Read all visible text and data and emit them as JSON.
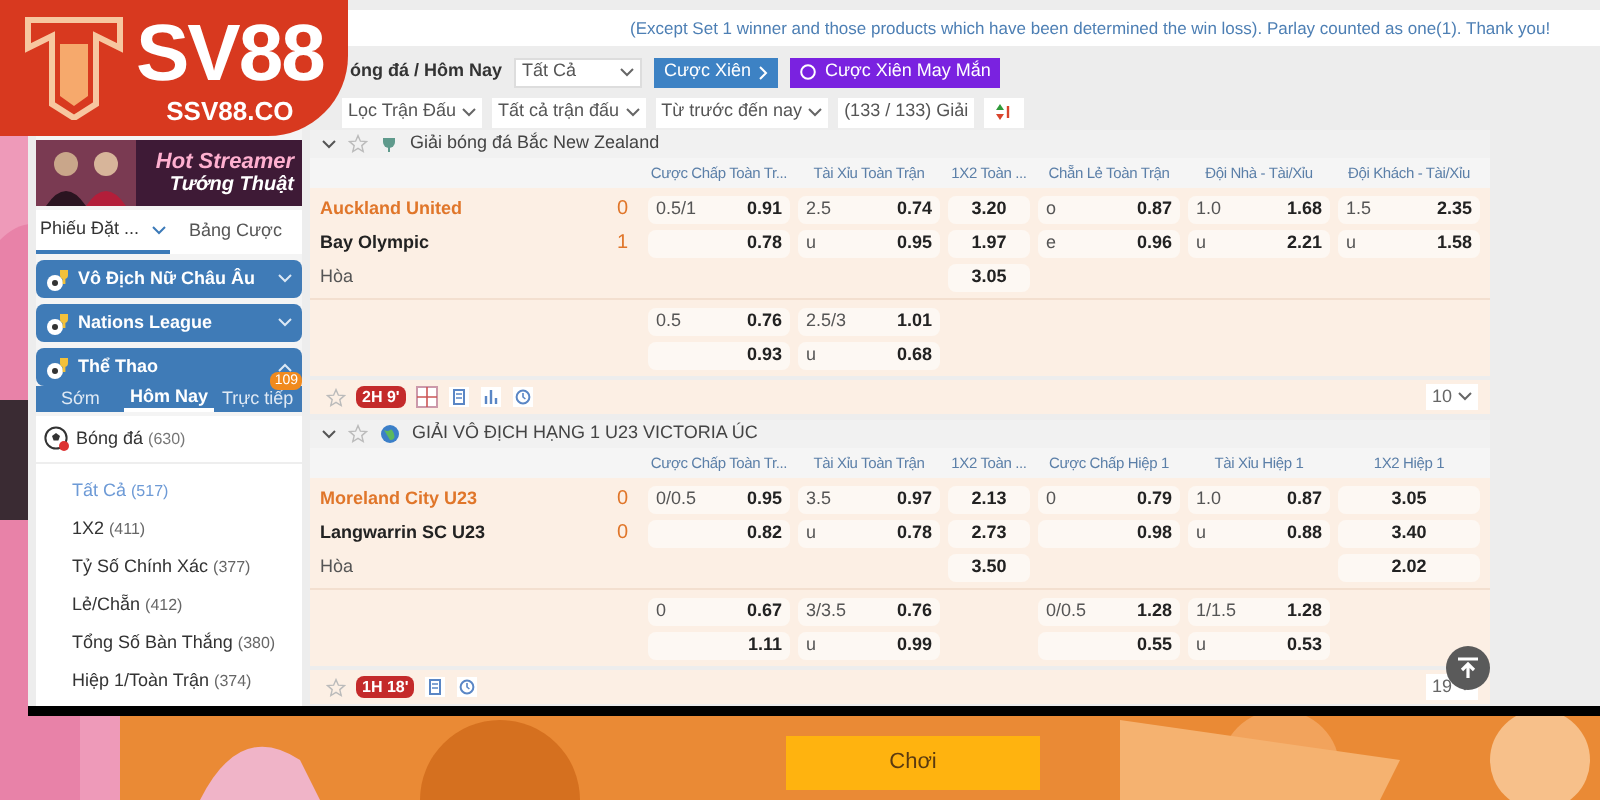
{
  "logo": {
    "name": "SV88",
    "domain": "SSV88.CO"
  },
  "notice": "(Except Set 1 winner and those products which have been determined the win loss). Parlay counted as one(1). Thank you!",
  "toolbar": {
    "breadcrumb": "óng đá / Hôm Nay",
    "market_select": "Tất Cả",
    "buttons": [
      {
        "label": "Cược Xiên",
        "kind": "parlay"
      },
      {
        "label": "Cược Xiên May Mắn",
        "kind": "lucky"
      }
    ]
  },
  "filters": [
    {
      "label": "Lọc Trận Đấu",
      "kind": "dropdown"
    },
    {
      "label": "Tất cả trận đấu",
      "kind": "dropdown"
    },
    {
      "label": "Từ trước đến nay",
      "kind": "dropdown"
    },
    {
      "label": "(133 / 133) Giải",
      "kind": "text"
    },
    {
      "kind": "sort"
    }
  ],
  "sidebar": {
    "banner": {
      "title": "Hot Streamer",
      "subtitle": "Tướng Thuật"
    },
    "tabs": [
      {
        "label": "Phiếu Đặt ...",
        "selected": true
      },
      {
        "label": "Bảng Cược",
        "selected": false
      }
    ],
    "sections": [
      {
        "label": "Vô Địch Nữ Châu Âu",
        "expanded": false
      },
      {
        "label": "Nations League",
        "expanded": false
      },
      {
        "label": "Thể Thao",
        "expanded": true
      }
    ],
    "period_tabs": [
      {
        "label": "Sớm",
        "selected": false
      },
      {
        "label": "Hôm Nay",
        "selected": true
      },
      {
        "label": "Trực tiếp",
        "selected": false,
        "badge": "109"
      }
    ],
    "sport": {
      "name": "Bóng đá",
      "count": "(630)"
    },
    "markets": [
      {
        "label": "Tất Cả",
        "count": "(517)",
        "selected": true
      },
      {
        "label": "1X2",
        "count": "(411)",
        "selected": false
      },
      {
        "label": "Tỷ Số Chính Xác",
        "count": "(377)",
        "selected": false
      },
      {
        "label": "Lẻ/Chẵn",
        "count": "(412)",
        "selected": false
      },
      {
        "label": "Tổng Số Bàn Thắng",
        "count": "(380)",
        "selected": false
      },
      {
        "label": "Hiệp 1/Toàn Trận",
        "count": "(374)",
        "selected": false
      }
    ]
  },
  "leagues": [
    {
      "name": "Giải bóng đá Bắc New Zealand",
      "columns": [
        {
          "label": "Cược Chấp Toàn Tr...",
          "kind": "line"
        },
        {
          "label": "Tài Xỉu Toàn Trận",
          "kind": "line"
        },
        {
          "label": "1X2 Toàn ...",
          "kind": "single"
        },
        {
          "label": "Chẵn Lẻ Toàn Trận",
          "kind": "line"
        },
        {
          "label": "Đội Nhà - Tài/Xỉu",
          "kind": "line"
        },
        {
          "label": "Đội Khách - Tài/Xỉu",
          "kind": "line"
        }
      ],
      "home": {
        "name": "Auckland United",
        "score": "0"
      },
      "away": {
        "name": "Bay Olympic",
        "score": "1"
      },
      "draw": "Hòa",
      "line_groups": [
        [
          {
            "kind": "odds",
            "cells": [
              {
                "label": "0.5/1",
                "odds": "0.91"
              },
              {
                "odds": "0.78"
              }
            ]
          },
          {
            "kind": "odds",
            "cells": [
              {
                "label": "2.5",
                "odds": "0.74"
              },
              {
                "label": "u",
                "odds": "0.95"
              }
            ]
          },
          {
            "kind": "odds",
            "cells": [
              {
                "odds": "3.20"
              },
              {
                "odds": "1.97"
              },
              {
                "odds": "3.05"
              }
            ]
          },
          {
            "kind": "odds",
            "cells": [
              {
                "label": "o",
                "odds": "0.87"
              },
              {
                "label": "e",
                "odds": "0.96"
              }
            ]
          },
          {
            "kind": "odds",
            "cells": [
              {
                "label": "1.0",
                "odds": "1.68"
              },
              {
                "label": "u",
                "odds": "2.21"
              }
            ]
          },
          {
            "kind": "odds",
            "cells": [
              {
                "label": "1.5",
                "odds": "2.35"
              },
              {
                "label": "u",
                "odds": "1.58"
              }
            ]
          }
        ],
        [
          {
            "kind": "odds",
            "cells": [
              {
                "label": "0.5",
                "odds": "0.76"
              },
              {
                "odds": "0.93"
              }
            ]
          },
          {
            "kind": "odds",
            "cells": [
              {
                "label": "2.5/3",
                "odds": "1.01"
              },
              {
                "label": "u",
                "odds": "0.68"
              }
            ]
          }
        ]
      ],
      "footer": {
        "live_time": "2H 9'",
        "page_size": "10"
      }
    },
    {
      "name": "GIẢI VÔ ĐỊCH HẠNG 1 U23 VICTORIA ÚC",
      "columns": [
        {
          "label": "Cược Chấp Toàn Tr...",
          "kind": "line"
        },
        {
          "label": "Tài Xỉu Toàn Trận",
          "kind": "line"
        },
        {
          "label": "1X2 Toàn ...",
          "kind": "single"
        },
        {
          "label": "Cược Chấp Hiệp 1",
          "kind": "line"
        },
        {
          "label": "Tài Xỉu Hiệp 1",
          "kind": "line"
        },
        {
          "label": "1X2 Hiệp 1",
          "kind": "single"
        }
      ],
      "home": {
        "name": "Moreland City U23",
        "score": "0"
      },
      "away": {
        "name": "Langwarrin SC U23",
        "score": "0"
      },
      "draw": "Hòa",
      "line_groups": [
        [
          {
            "kind": "odds",
            "cells": [
              {
                "label": "0/0.5",
                "odds": "0.95"
              },
              {
                "odds": "0.82"
              }
            ]
          },
          {
            "kind": "odds",
            "cells": [
              {
                "label": "3.5",
                "odds": "0.97"
              },
              {
                "label": "u",
                "odds": "0.78"
              }
            ]
          },
          {
            "kind": "odds",
            "cells": [
              {
                "odds": "2.13"
              },
              {
                "odds": "2.73"
              },
              {
                "odds": "3.50"
              }
            ]
          },
          {
            "kind": "odds",
            "cells": [
              {
                "label": "0",
                "odds": "0.79"
              },
              {
                "odds": "0.98"
              }
            ]
          },
          {
            "kind": "odds",
            "cells": [
              {
                "label": "1.0",
                "odds": "0.87"
              },
              {
                "label": "u",
                "odds": "0.88"
              }
            ]
          },
          {
            "kind": "odds",
            "cells": [
              {
                "odds": "3.05"
              },
              {
                "odds": "3.40"
              },
              {
                "odds": "2.02"
              }
            ]
          }
        ],
        [
          {
            "kind": "odds",
            "cells": [
              {
                "label": "0",
                "odds": "0.67"
              },
              {
                "odds": "1.11"
              }
            ]
          },
          {
            "kind": "odds",
            "cells": [
              {
                "label": "3/3.5",
                "odds": "0.76"
              },
              {
                "label": "u",
                "odds": "0.99"
              }
            ]
          },
          {
            "kind": "blank"
          },
          {
            "kind": "odds",
            "cells": [
              {
                "label": "0/0.5",
                "odds": "1.28"
              },
              {
                "odds": "0.55"
              }
            ]
          },
          {
            "kind": "odds",
            "cells": [
              {
                "label": "1/1.5",
                "odds": "1.28"
              },
              {
                "label": "u",
                "odds": "0.53"
              }
            ]
          }
        ]
      ],
      "footer": {
        "live_time": "1H 18'",
        "page_size": "19"
      }
    }
  ],
  "play_button": "Chơi"
}
